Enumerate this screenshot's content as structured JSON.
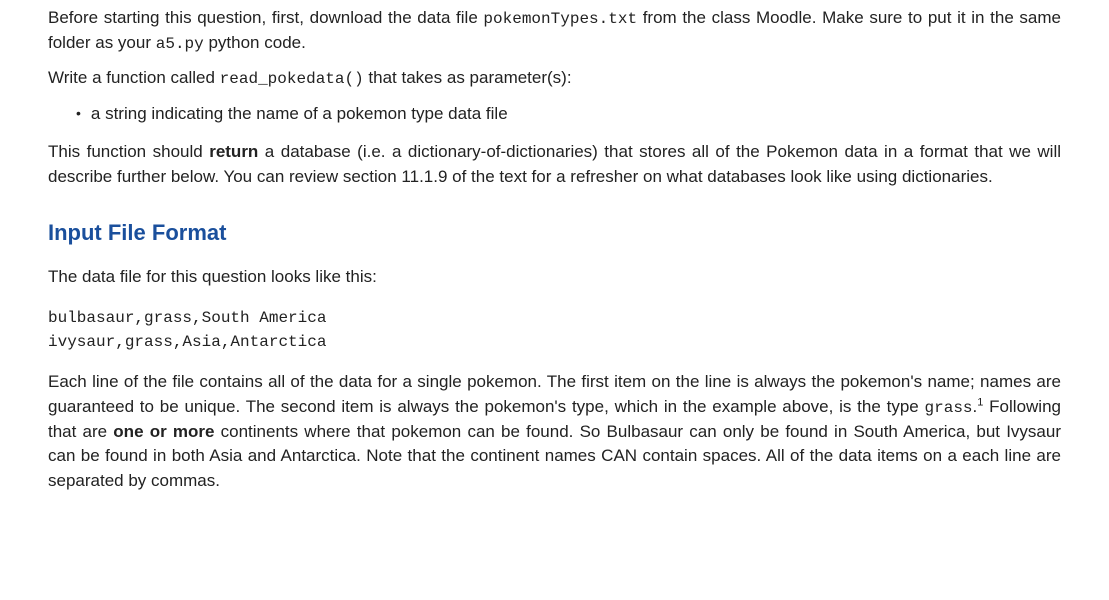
{
  "intro": {
    "p1_a": "Before starting this question, first, download the data file ",
    "p1_code1": "pokemonTypes.txt",
    "p1_b": " from the class Moodle. Make sure to put it in the same folder as your ",
    "p1_code2": "a5.py",
    "p1_c": " python code.",
    "p2_a": "Write a function called ",
    "p2_code1": "read_pokedata()",
    "p2_b": " that takes as parameter(s):",
    "bullet1": "a string indicating the name of a pokemon type data file",
    "p3_a": "This function should ",
    "p3_strong": "return",
    "p3_b": " a database (i.e. a dictionary-of-dictionaries) that stores all of the Pokemon data in a format that we will describe further below. You can review section 11.1.9 of the text for a refresher on what databases look like using dictionaries."
  },
  "section": {
    "heading": "Input File Format",
    "p1": "The data file for this question looks like this:",
    "code_line1": "bulbasaur,grass,South America",
    "code_line2": "ivysaur,grass,Asia,Antarctica",
    "p2_a": "Each line of the file contains all of the data for a single pokemon. The first item on the line is always the pokemon's name; names are guaranteed to be unique. The second item is always the pokemon's type, which in the example above, is the type ",
    "p2_code": "grass",
    "p2_dot": ".",
    "p2_sup": "1",
    "p2_b": " Following that are ",
    "p2_strong": "one or more",
    "p2_c": " continents where that pokemon can be found. So Bulbasaur can only be found in South America, but Ivysaur can be found in both Asia and Antarctica. Note that the continent names CAN contain spaces. All of the data items on a each line are separated by commas."
  }
}
